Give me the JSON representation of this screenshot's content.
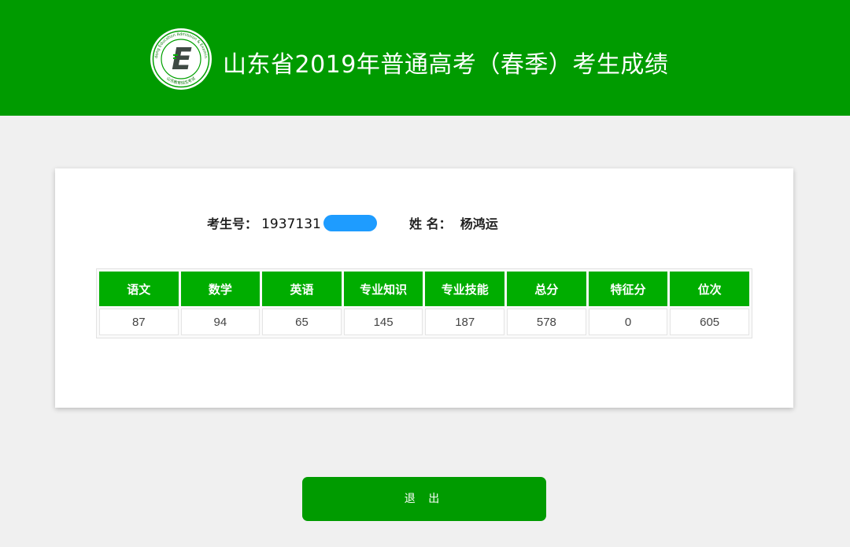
{
  "header": {
    "title": "山东省2019年普通高考（春季）考生成绩",
    "logo": {
      "icon": "shandong-education-exam-logo",
      "letter": "E",
      "ring_text_top": "Shandong Education Admission & Examination",
      "ring_text_bottom": "山东教育招生考试"
    },
    "background_color": "#009b00"
  },
  "student": {
    "exam_no_label": "考生号：",
    "exam_no_value": "1937131",
    "exam_no_redacted": true,
    "name_label": "姓 名：",
    "name_value": "杨鸿运"
  },
  "scores": {
    "headers": [
      "语文",
      "数学",
      "英语",
      "专业知识",
      "专业技能",
      "总分",
      "特征分",
      "位次"
    ],
    "values": [
      "87",
      "94",
      "65",
      "145",
      "187",
      "578",
      "0",
      "605"
    ]
  },
  "actions": {
    "exit_label": "退 出"
  },
  "colors": {
    "primary_green": "#009b00",
    "header_cell_green": "#00ad00",
    "redaction_blue": "#1e9cff",
    "page_background": "#f0f0f0"
  }
}
